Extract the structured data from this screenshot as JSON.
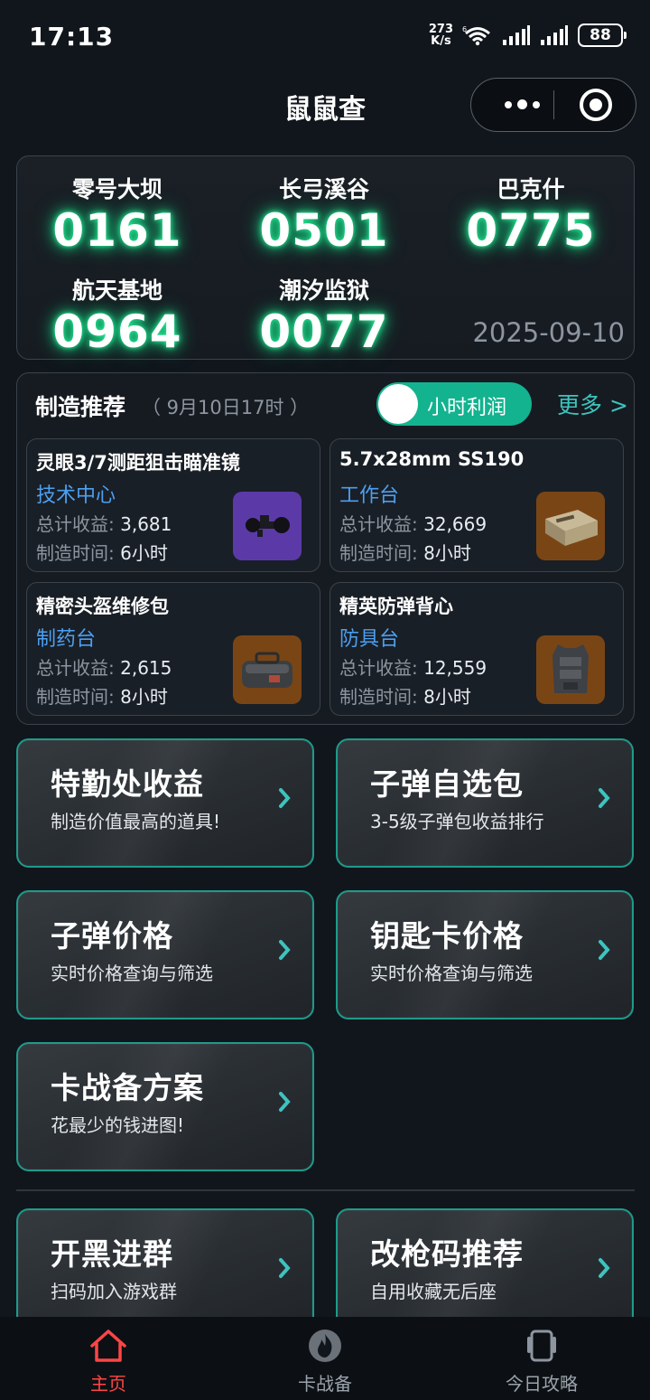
{
  "status_bar": {
    "time": "17:13",
    "speed_value": "273",
    "speed_unit": "K/s",
    "wifi_badge": "6",
    "battery": "88"
  },
  "nav": {
    "title": "鼠鼠查",
    "more_icon": "more-dots-icon",
    "close_icon": "target-close-icon"
  },
  "codes": {
    "items": [
      {
        "name": "零号大坝",
        "code": "0161"
      },
      {
        "name": "长弓溪谷",
        "code": "0501"
      },
      {
        "name": "巴克什",
        "code": "0775"
      },
      {
        "name": "航天基地",
        "code": "0964"
      },
      {
        "name": "潮汐监狱",
        "code": "0077"
      }
    ],
    "date": "2025-09-10",
    "glow_color": "#16d886"
  },
  "recommend": {
    "title": "制造推荐",
    "subtitle": "（ 9月10日17时 ）",
    "toggle_label": "小时利润",
    "more_label": "更多 >",
    "income_label": "总计收益:",
    "time_label": "制造时间:",
    "cards": [
      {
        "name": "灵眼3/7测距狙击瞄准镜",
        "station": "技术中心",
        "income": "3,681",
        "time": "6小时",
        "thumb": "scope-icon"
      },
      {
        "name": "5.7x28mm SS190",
        "station": "工作台",
        "income": "32,669",
        "time": "8小时",
        "thumb": "ammo-box-icon"
      },
      {
        "name": "精密头盔维修包",
        "station": "制药台",
        "income": "2,615",
        "time": "8小时",
        "thumb": "repair-kit-icon"
      },
      {
        "name": "精英防弹背心",
        "station": "防具台",
        "income": "12,559",
        "time": "8小时",
        "thumb": "vest-icon"
      }
    ]
  },
  "tiles": [
    {
      "title": "特勤处收益",
      "desc": "制造价值最高的道具!"
    },
    {
      "title": "子弹自选包",
      "desc": "3-5级子弹包收益排行"
    },
    {
      "title": "子弹价格",
      "desc": "实时价格查询与筛选"
    },
    {
      "title": "钥匙卡价格",
      "desc": "实时价格查询与筛选"
    },
    {
      "title": "卡战备方案",
      "desc": "花最少的钱进图!"
    },
    {
      "title": "开黑进群",
      "desc": "扫码加入游戏群"
    },
    {
      "title": "改枪码推荐",
      "desc": "自用收藏无后座"
    }
  ],
  "tabbar": {
    "tabs": [
      {
        "label": "主页",
        "icon": "home-icon",
        "active": true
      },
      {
        "label": "卡战备",
        "icon": "flame-icon",
        "active": false
      },
      {
        "label": "今日攻略",
        "icon": "phone-icon",
        "active": false
      }
    ]
  },
  "colors": {
    "accent_teal": "#13b38f",
    "link_blue": "#4d9ff0",
    "tile_border": "#1f9a8a",
    "active_tab": "#ff4545"
  }
}
